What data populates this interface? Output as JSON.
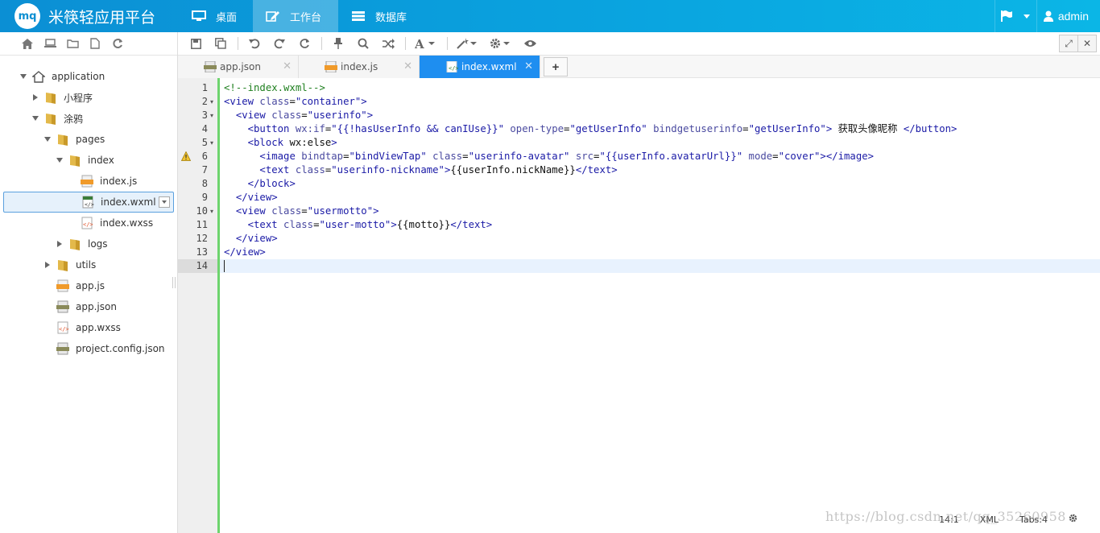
{
  "app": {
    "logo_text": "mq",
    "title": "米筷轻应用平台",
    "accent": "#0c95d8"
  },
  "nav": [
    {
      "label": "桌面",
      "icon": "desktop-icon"
    },
    {
      "label": "工作台",
      "icon": "edit-icon",
      "active": true
    },
    {
      "label": "数据库",
      "icon": "database-icon"
    }
  ],
  "user": {
    "name": "admin"
  },
  "tree": [
    {
      "label": "application",
      "depth": 0,
      "type": "home",
      "expanded": true
    },
    {
      "label": "小程序",
      "depth": 1,
      "type": "folder",
      "expanded": false
    },
    {
      "label": "涂鸦",
      "depth": 1,
      "type": "folder",
      "expanded": true
    },
    {
      "label": "pages",
      "depth": 2,
      "type": "folder",
      "expanded": true
    },
    {
      "label": "index",
      "depth": 3,
      "type": "folder",
      "expanded": true
    },
    {
      "label": "index.js",
      "depth": 4,
      "type": "js"
    },
    {
      "label": "index.wxml",
      "depth": 4,
      "type": "wxml",
      "selected": true
    },
    {
      "label": "index.wxss",
      "depth": 4,
      "type": "wxss"
    },
    {
      "label": "logs",
      "depth": 3,
      "type": "folder",
      "expanded": false
    },
    {
      "label": "utils",
      "depth": 2,
      "type": "folder",
      "expanded": false
    },
    {
      "label": "app.js",
      "depth": 2,
      "type": "js"
    },
    {
      "label": "app.json",
      "depth": 2,
      "type": "json"
    },
    {
      "label": "app.wxss",
      "depth": 2,
      "type": "wxss"
    },
    {
      "label": "project.config.json",
      "depth": 2,
      "type": "json"
    }
  ],
  "tabs": [
    {
      "label": "app.json",
      "type": "json"
    },
    {
      "label": "index.js",
      "type": "js"
    },
    {
      "label": "index.wxml",
      "type": "wxml",
      "active": true
    }
  ],
  "tab_add": "+",
  "code": [
    "<!--index.wxml-->",
    "<view class=\"container\">",
    "  <view class=\"userinfo\">",
    "    <button wx:if=\"{{!hasUserInfo && canIUse}}\" open-type=\"getUserInfo\" bindgetuserinfo=\"getUserInfo\"> 获取头像昵称 </button>",
    "    <block wx:else>",
    "      <image bindtap=\"bindViewTap\" class=\"userinfo-avatar\" src=\"{{userInfo.avatarUrl}}\" mode=\"cover\"></image>",
    "      <text class=\"userinfo-nickname\">{{userInfo.nickName}}</text>",
    "    </block>",
    "  </view>",
    "  <view class=\"usermotto\">",
    "    <text class=\"user-motto\">{{motto}}</text>",
    "  </view>",
    "</view>",
    ""
  ],
  "fold_lines": [
    2,
    3,
    5,
    10
  ],
  "warning_line": 6,
  "active_line": 14,
  "status": {
    "position": "14:1",
    "mode": "XML",
    "tabs": "Tabs:4"
  },
  "watermark": "https://blog.csdn.net/qq_35260958"
}
